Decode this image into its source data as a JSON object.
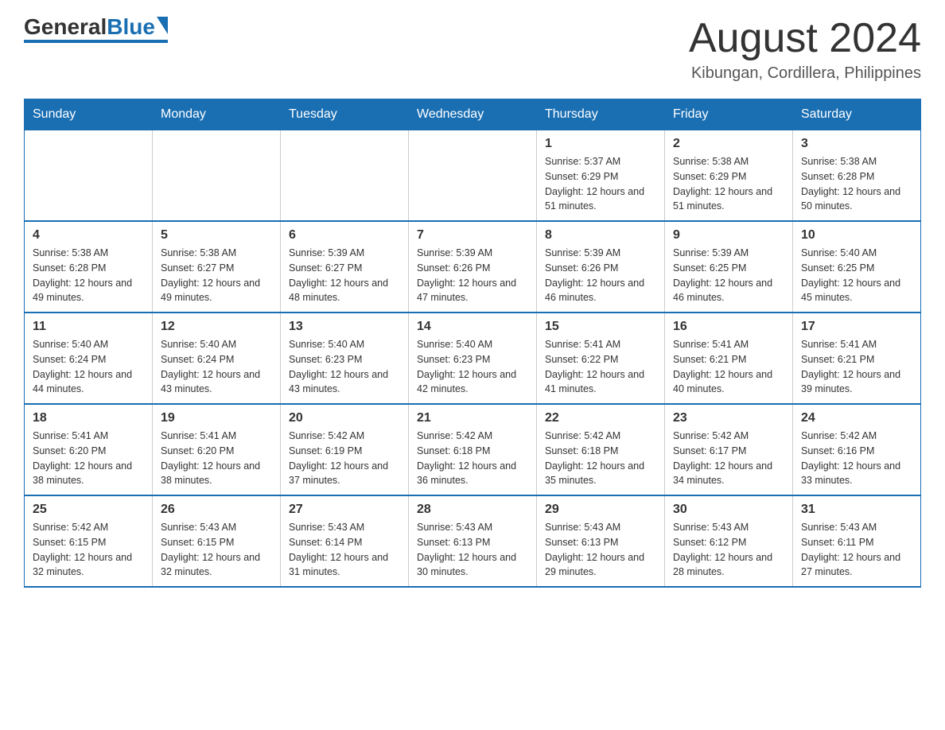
{
  "logo": {
    "text_general": "General",
    "text_blue": "Blue"
  },
  "title": {
    "month_year": "August 2024",
    "location": "Kibungan, Cordillera, Philippines"
  },
  "weekdays": [
    "Sunday",
    "Monday",
    "Tuesday",
    "Wednesday",
    "Thursday",
    "Friday",
    "Saturday"
  ],
  "weeks": [
    [
      {
        "day": "",
        "info": ""
      },
      {
        "day": "",
        "info": ""
      },
      {
        "day": "",
        "info": ""
      },
      {
        "day": "",
        "info": ""
      },
      {
        "day": "1",
        "info": "Sunrise: 5:37 AM\nSunset: 6:29 PM\nDaylight: 12 hours and 51 minutes."
      },
      {
        "day": "2",
        "info": "Sunrise: 5:38 AM\nSunset: 6:29 PM\nDaylight: 12 hours and 51 minutes."
      },
      {
        "day": "3",
        "info": "Sunrise: 5:38 AM\nSunset: 6:28 PM\nDaylight: 12 hours and 50 minutes."
      }
    ],
    [
      {
        "day": "4",
        "info": "Sunrise: 5:38 AM\nSunset: 6:28 PM\nDaylight: 12 hours and 49 minutes."
      },
      {
        "day": "5",
        "info": "Sunrise: 5:38 AM\nSunset: 6:27 PM\nDaylight: 12 hours and 49 minutes."
      },
      {
        "day": "6",
        "info": "Sunrise: 5:39 AM\nSunset: 6:27 PM\nDaylight: 12 hours and 48 minutes."
      },
      {
        "day": "7",
        "info": "Sunrise: 5:39 AM\nSunset: 6:26 PM\nDaylight: 12 hours and 47 minutes."
      },
      {
        "day": "8",
        "info": "Sunrise: 5:39 AM\nSunset: 6:26 PM\nDaylight: 12 hours and 46 minutes."
      },
      {
        "day": "9",
        "info": "Sunrise: 5:39 AM\nSunset: 6:25 PM\nDaylight: 12 hours and 46 minutes."
      },
      {
        "day": "10",
        "info": "Sunrise: 5:40 AM\nSunset: 6:25 PM\nDaylight: 12 hours and 45 minutes."
      }
    ],
    [
      {
        "day": "11",
        "info": "Sunrise: 5:40 AM\nSunset: 6:24 PM\nDaylight: 12 hours and 44 minutes."
      },
      {
        "day": "12",
        "info": "Sunrise: 5:40 AM\nSunset: 6:24 PM\nDaylight: 12 hours and 43 minutes."
      },
      {
        "day": "13",
        "info": "Sunrise: 5:40 AM\nSunset: 6:23 PM\nDaylight: 12 hours and 43 minutes."
      },
      {
        "day": "14",
        "info": "Sunrise: 5:40 AM\nSunset: 6:23 PM\nDaylight: 12 hours and 42 minutes."
      },
      {
        "day": "15",
        "info": "Sunrise: 5:41 AM\nSunset: 6:22 PM\nDaylight: 12 hours and 41 minutes."
      },
      {
        "day": "16",
        "info": "Sunrise: 5:41 AM\nSunset: 6:21 PM\nDaylight: 12 hours and 40 minutes."
      },
      {
        "day": "17",
        "info": "Sunrise: 5:41 AM\nSunset: 6:21 PM\nDaylight: 12 hours and 39 minutes."
      }
    ],
    [
      {
        "day": "18",
        "info": "Sunrise: 5:41 AM\nSunset: 6:20 PM\nDaylight: 12 hours and 38 minutes."
      },
      {
        "day": "19",
        "info": "Sunrise: 5:41 AM\nSunset: 6:20 PM\nDaylight: 12 hours and 38 minutes."
      },
      {
        "day": "20",
        "info": "Sunrise: 5:42 AM\nSunset: 6:19 PM\nDaylight: 12 hours and 37 minutes."
      },
      {
        "day": "21",
        "info": "Sunrise: 5:42 AM\nSunset: 6:18 PM\nDaylight: 12 hours and 36 minutes."
      },
      {
        "day": "22",
        "info": "Sunrise: 5:42 AM\nSunset: 6:18 PM\nDaylight: 12 hours and 35 minutes."
      },
      {
        "day": "23",
        "info": "Sunrise: 5:42 AM\nSunset: 6:17 PM\nDaylight: 12 hours and 34 minutes."
      },
      {
        "day": "24",
        "info": "Sunrise: 5:42 AM\nSunset: 6:16 PM\nDaylight: 12 hours and 33 minutes."
      }
    ],
    [
      {
        "day": "25",
        "info": "Sunrise: 5:42 AM\nSunset: 6:15 PM\nDaylight: 12 hours and 32 minutes."
      },
      {
        "day": "26",
        "info": "Sunrise: 5:43 AM\nSunset: 6:15 PM\nDaylight: 12 hours and 32 minutes."
      },
      {
        "day": "27",
        "info": "Sunrise: 5:43 AM\nSunset: 6:14 PM\nDaylight: 12 hours and 31 minutes."
      },
      {
        "day": "28",
        "info": "Sunrise: 5:43 AM\nSunset: 6:13 PM\nDaylight: 12 hours and 30 minutes."
      },
      {
        "day": "29",
        "info": "Sunrise: 5:43 AM\nSunset: 6:13 PM\nDaylight: 12 hours and 29 minutes."
      },
      {
        "day": "30",
        "info": "Sunrise: 5:43 AM\nSunset: 6:12 PM\nDaylight: 12 hours and 28 minutes."
      },
      {
        "day": "31",
        "info": "Sunrise: 5:43 AM\nSunset: 6:11 PM\nDaylight: 12 hours and 27 minutes."
      }
    ]
  ]
}
